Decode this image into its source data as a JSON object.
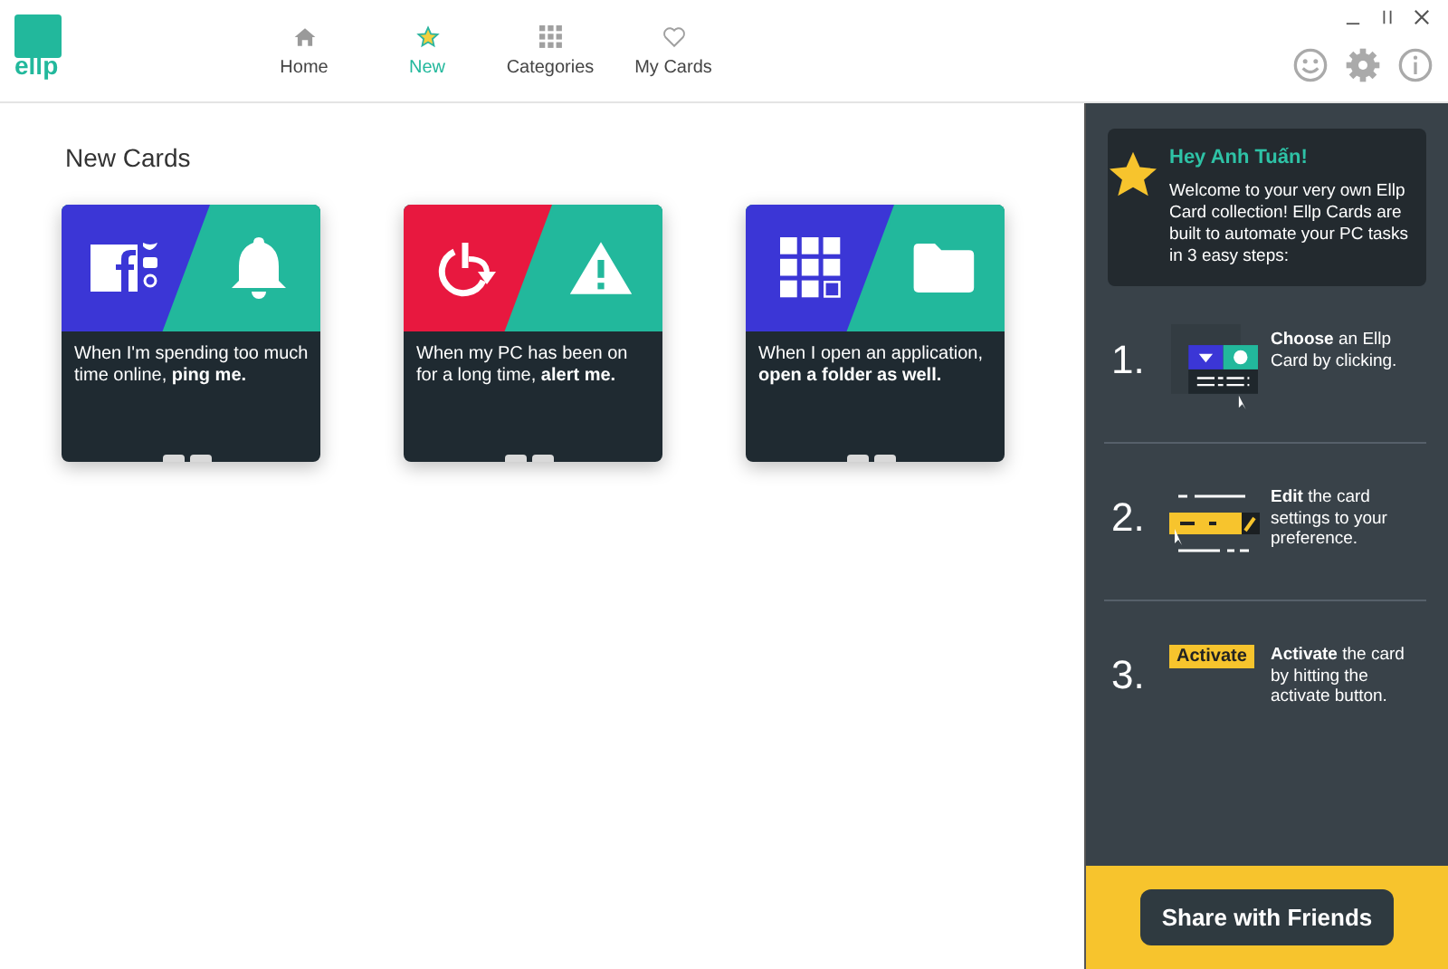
{
  "logo": {
    "text": "ellp"
  },
  "nav": [
    {
      "label": "Home",
      "selected": false,
      "kind": "home"
    },
    {
      "label": "New",
      "selected": true,
      "kind": "star"
    },
    {
      "label": "Categories",
      "selected": false,
      "kind": "grid"
    },
    {
      "label": "My Cards",
      "selected": false,
      "kind": "heart"
    }
  ],
  "section_title": "New Cards",
  "cards": [
    {
      "kind": "social-bell",
      "color": "#3b36d6",
      "text": "When I'm spending too much time online, **ping me.**"
    },
    {
      "kind": "power-alert",
      "color": "#e8183f",
      "text": "When my PC has been on for a long time, **alert me.**"
    },
    {
      "kind": "apps-folder",
      "color": "#3b36d6",
      "text": "When I open an application, **open a folder as well.**"
    }
  ],
  "welcome": {
    "title": "Hey Anh Tuấn!",
    "message": "Welcome to your very own Ellp Card collection! Ellp Cards are built to automate your PC tasks in 3 easy steps:"
  },
  "steps": [
    {
      "number": "1.",
      "kind": "choose",
      "text": "**Choose** an Ellp Card by clicking."
    },
    {
      "number": "2.",
      "kind": "edit",
      "text": "**Edit** the card settings to your preference."
    },
    {
      "number": "3.",
      "kind": "activate",
      "badge": "Activate",
      "text": "**Activate** the card by hitting the activate button."
    }
  ],
  "share_button": "Share with Friends"
}
